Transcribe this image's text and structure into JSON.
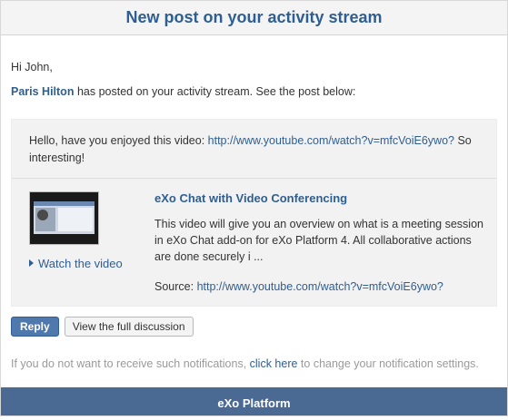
{
  "header": {
    "title": "New post on your activity stream"
  },
  "greeting": "Hi John,",
  "intro": {
    "author": "Paris Hilton",
    "text": " has posted on your activity stream. See the post below:"
  },
  "post": {
    "message_prefix": "Hello, have you enjoyed this video: ",
    "message_link": "http://www.youtube.com/watch?v=mfcVoiE6ywo?",
    "message_suffix": " So interesting!"
  },
  "embed": {
    "title": "eXo Chat with Video Conferencing",
    "description": "This video will give you an overview on what is a meeting session in eXo Chat add-on for eXo Platform 4. All collaborative actions are done securely i ...",
    "source_label": "Source: ",
    "source_link": "http://www.youtube.com/watch?v=mfcVoiE6ywo?",
    "watch_label": "Watch the video",
    "watch_icon": "play-triangle-icon"
  },
  "actions": {
    "reply_label": "Reply",
    "discuss_label": "View the full discussion"
  },
  "footer_note": {
    "prefix": "If you do not want to receive such notifications, ",
    "link": "click here",
    "suffix": " to change your notification settings."
  },
  "footer": {
    "brand": "eXo Platform"
  },
  "colors": {
    "accent": "#2f5e92",
    "footer_bg": "#4a6a94",
    "panel_bg": "#f2f2f2"
  }
}
